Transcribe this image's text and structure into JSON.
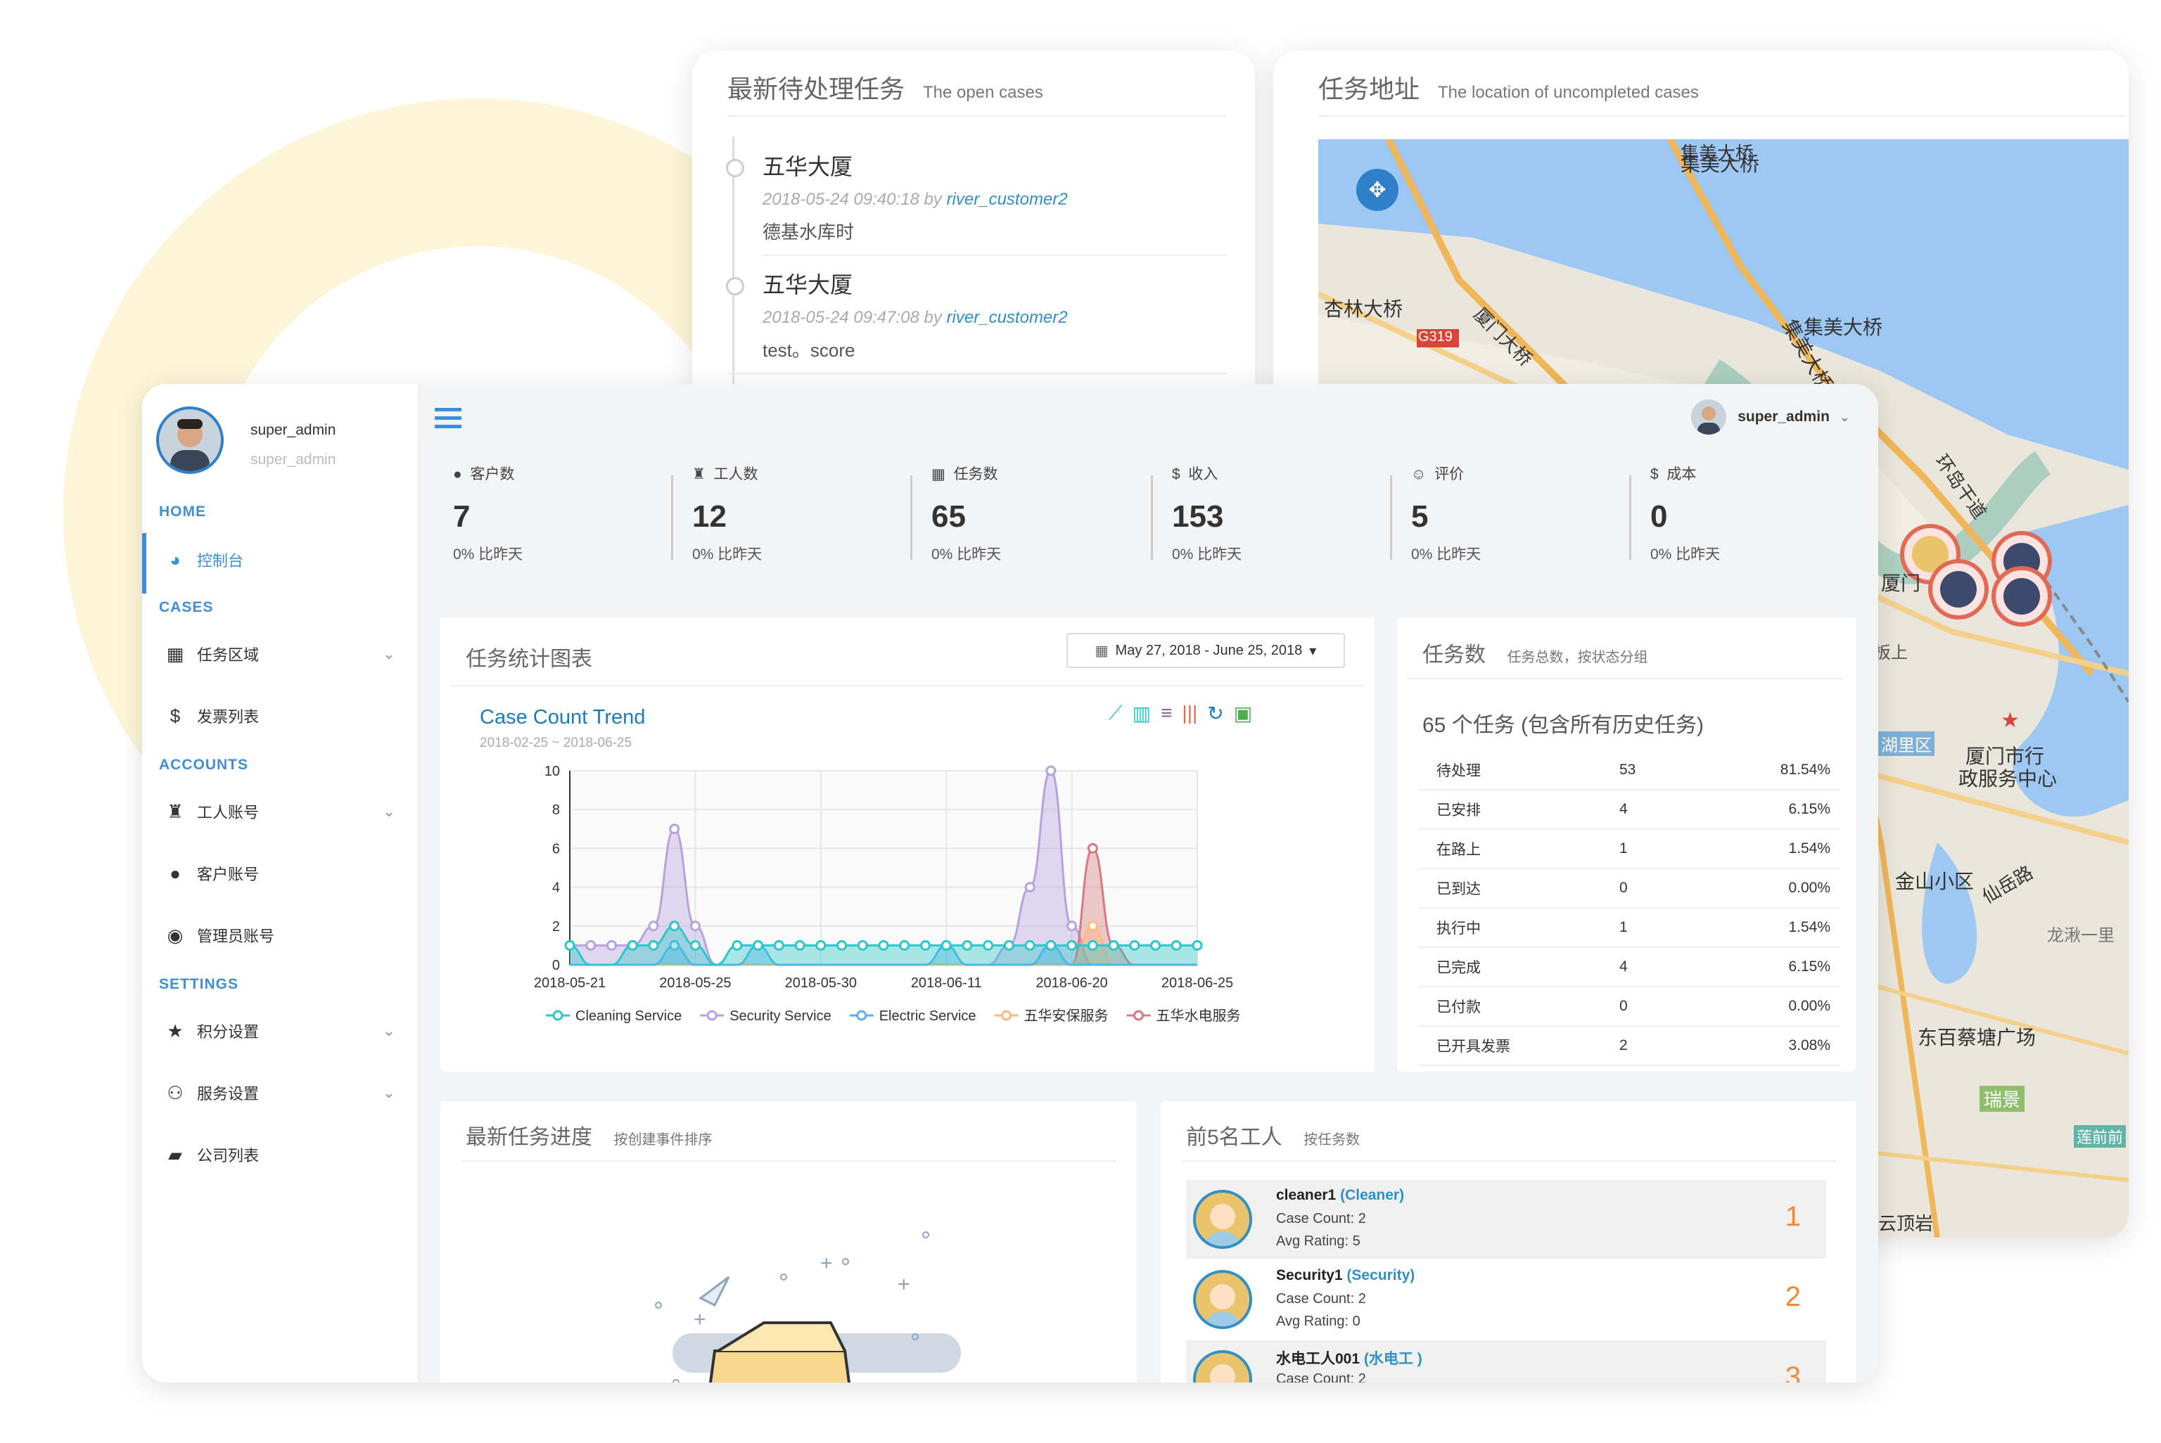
{
  "open_cases": {
    "title": "最新待处理任务",
    "subtitle": "The open cases",
    "items": [
      {
        "title": "五华大厦",
        "time": "2018-05-24 09:40:18",
        "by": "by",
        "user": "river_customer2",
        "desc": "德基水库时"
      },
      {
        "title": "五华大厦",
        "time": "2018-05-24 09:47:08",
        "by": "by",
        "user": "river_customer2",
        "desc": "test。score"
      }
    ]
  },
  "map_card": {
    "title": "任务地址",
    "subtitle": "The location of uncompleted cases",
    "labels": [
      "集美大桥",
      "集美大桥",
      "集美大桥",
      "杏林大桥",
      "厦门大桥",
      "G319",
      "环岛干道",
      "厦门",
      "板上",
      "厦门市行",
      "政服务中心",
      "金山小区",
      "仙岳路",
      "龙湫一里",
      "东百蔡塘广场",
      "瑞景",
      "云顶岩",
      "湖里区",
      "莲前前"
    ]
  },
  "user": {
    "name": "super_admin",
    "role": "super_admin",
    "header_name": "super_admin"
  },
  "sidebar": {
    "sections": [
      {
        "heading": "HOME",
        "items": [
          {
            "label": "控制台",
            "icon": "dashboard-icon"
          }
        ]
      },
      {
        "heading": "CASES",
        "items": [
          {
            "label": "任务区域",
            "icon": "table-icon"
          },
          {
            "label": "发票列表",
            "icon": "dollar-icon"
          }
        ]
      },
      {
        "heading": "ACCOUNTS",
        "items": [
          {
            "label": "工人账号",
            "icon": "worker-icon"
          },
          {
            "label": "客户账号",
            "icon": "user-icon"
          },
          {
            "label": "管理员账号",
            "icon": "admin-icon"
          }
        ]
      },
      {
        "heading": "SETTINGS",
        "items": [
          {
            "label": "积分设置",
            "icon": "star-icon"
          },
          {
            "label": "服务设置",
            "icon": "handshake-icon"
          },
          {
            "label": "公司列表",
            "icon": "briefcase-icon"
          }
        ]
      }
    ]
  },
  "stats": [
    {
      "icon": "user-icon",
      "label": "客户数",
      "value": "7",
      "change": "0% 比昨天"
    },
    {
      "icon": "worker-icon",
      "label": "工人数",
      "value": "12",
      "change": "0% 比昨天"
    },
    {
      "icon": "table-icon",
      "label": "任务数",
      "value": "65",
      "change": "0% 比昨天"
    },
    {
      "icon": "dollar-icon",
      "label": "收入",
      "value": "153",
      "change": "0% 比昨天"
    },
    {
      "icon": "smile-icon",
      "label": "评价",
      "value": "5",
      "change": "0% 比昨天"
    },
    {
      "icon": "dollar-icon",
      "label": "成本",
      "value": "0",
      "change": "0% 比昨天"
    }
  ],
  "chart_card": {
    "title": "任务统计图表",
    "date_range": "May 27, 2018 - June 25, 2018",
    "chart_title": "Case Count Trend",
    "chart_subtitle": "2018-02-25 ~ 2018-06-25"
  },
  "chart_data": {
    "type": "area",
    "x_labels": [
      "2018-05-21",
      "2018-05-25",
      "2018-05-30",
      "2018-06-11",
      "2018-06-20",
      "2018-06-25"
    ],
    "ylim": [
      0,
      10
    ],
    "yticks": [
      0,
      2,
      4,
      6,
      8,
      10
    ],
    "points": 31,
    "series": [
      {
        "name": "Cleaning Service",
        "color": "#2ec7c9",
        "values": [
          1,
          0,
          0,
          1,
          1,
          2,
          1,
          0,
          1,
          1,
          1,
          1,
          1,
          1,
          1,
          1,
          1,
          1,
          1,
          1,
          1,
          1,
          1,
          1,
          1,
          1,
          1,
          1,
          1,
          1,
          1
        ]
      },
      {
        "name": "Security Service",
        "color": "#b6a2de",
        "values": [
          1,
          1,
          1,
          1,
          2,
          7,
          2,
          0,
          0,
          0,
          0,
          0,
          0,
          0,
          0,
          0,
          0,
          0,
          0,
          0,
          0,
          1,
          4,
          10,
          2,
          0,
          0,
          0,
          0,
          0,
          0
        ]
      },
      {
        "name": "Electric Service",
        "color": "#5ab1ef",
        "values": [
          0,
          0,
          0,
          0,
          0,
          1,
          0,
          0,
          0,
          1,
          0,
          0,
          0,
          0,
          0,
          0,
          0,
          0,
          1,
          0,
          0,
          0,
          0,
          1,
          0,
          0,
          0,
          0,
          0,
          0,
          0
        ]
      },
      {
        "name": "五华安保服务",
        "color": "#ffb980",
        "values": [
          0,
          0,
          0,
          0,
          0,
          0,
          0,
          0,
          0,
          0,
          0,
          0,
          0,
          0,
          0,
          0,
          0,
          0,
          0,
          0,
          0,
          0,
          0,
          0,
          0,
          2,
          0,
          0,
          0,
          0,
          0
        ]
      },
      {
        "name": "五华水电服务",
        "color": "#d87a80",
        "values": [
          0,
          0,
          0,
          0,
          0,
          0,
          0,
          0,
          0,
          0,
          0,
          0,
          0,
          0,
          0,
          0,
          0,
          0,
          0,
          0,
          0,
          0,
          0,
          0,
          0,
          6,
          1,
          0,
          0,
          0,
          0
        ]
      }
    ]
  },
  "status_card": {
    "title": "任务数",
    "subtitle": "任务总数，按状态分组",
    "summary": "65 个任务 (包含所有历史任务)",
    "rows": [
      {
        "status": "待处理",
        "count": "53",
        "pct": "81.54%"
      },
      {
        "status": "已安排",
        "count": "4",
        "pct": "6.15%"
      },
      {
        "status": "在路上",
        "count": "1",
        "pct": "1.54%"
      },
      {
        "status": "已到达",
        "count": "0",
        "pct": "0.00%"
      },
      {
        "status": "执行中",
        "count": "1",
        "pct": "1.54%"
      },
      {
        "status": "已完成",
        "count": "4",
        "pct": "6.15%"
      },
      {
        "status": "已付款",
        "count": "0",
        "pct": "0.00%"
      },
      {
        "status": "已开具发票",
        "count": "2",
        "pct": "3.08%"
      }
    ]
  },
  "progress_card": {
    "title": "最新任务进度",
    "subtitle": "按创建事件排序"
  },
  "workers_card": {
    "title": "前5名工人",
    "subtitle": "按任务数",
    "workers": [
      {
        "name": "cleaner1",
        "role": "(Cleaner)",
        "cases": "Case Count: 2",
        "rating": "Avg Rating: 5",
        "rank": "1"
      },
      {
        "name": "Security1",
        "role": "(Security)",
        "cases": "Case Count: 2",
        "rating": "Avg Rating: 0",
        "rank": "2"
      },
      {
        "name": "水电工人001",
        "role": "(水电工 )",
        "cases": "Case Count: 2",
        "rating": "",
        "rank": "3"
      }
    ]
  }
}
